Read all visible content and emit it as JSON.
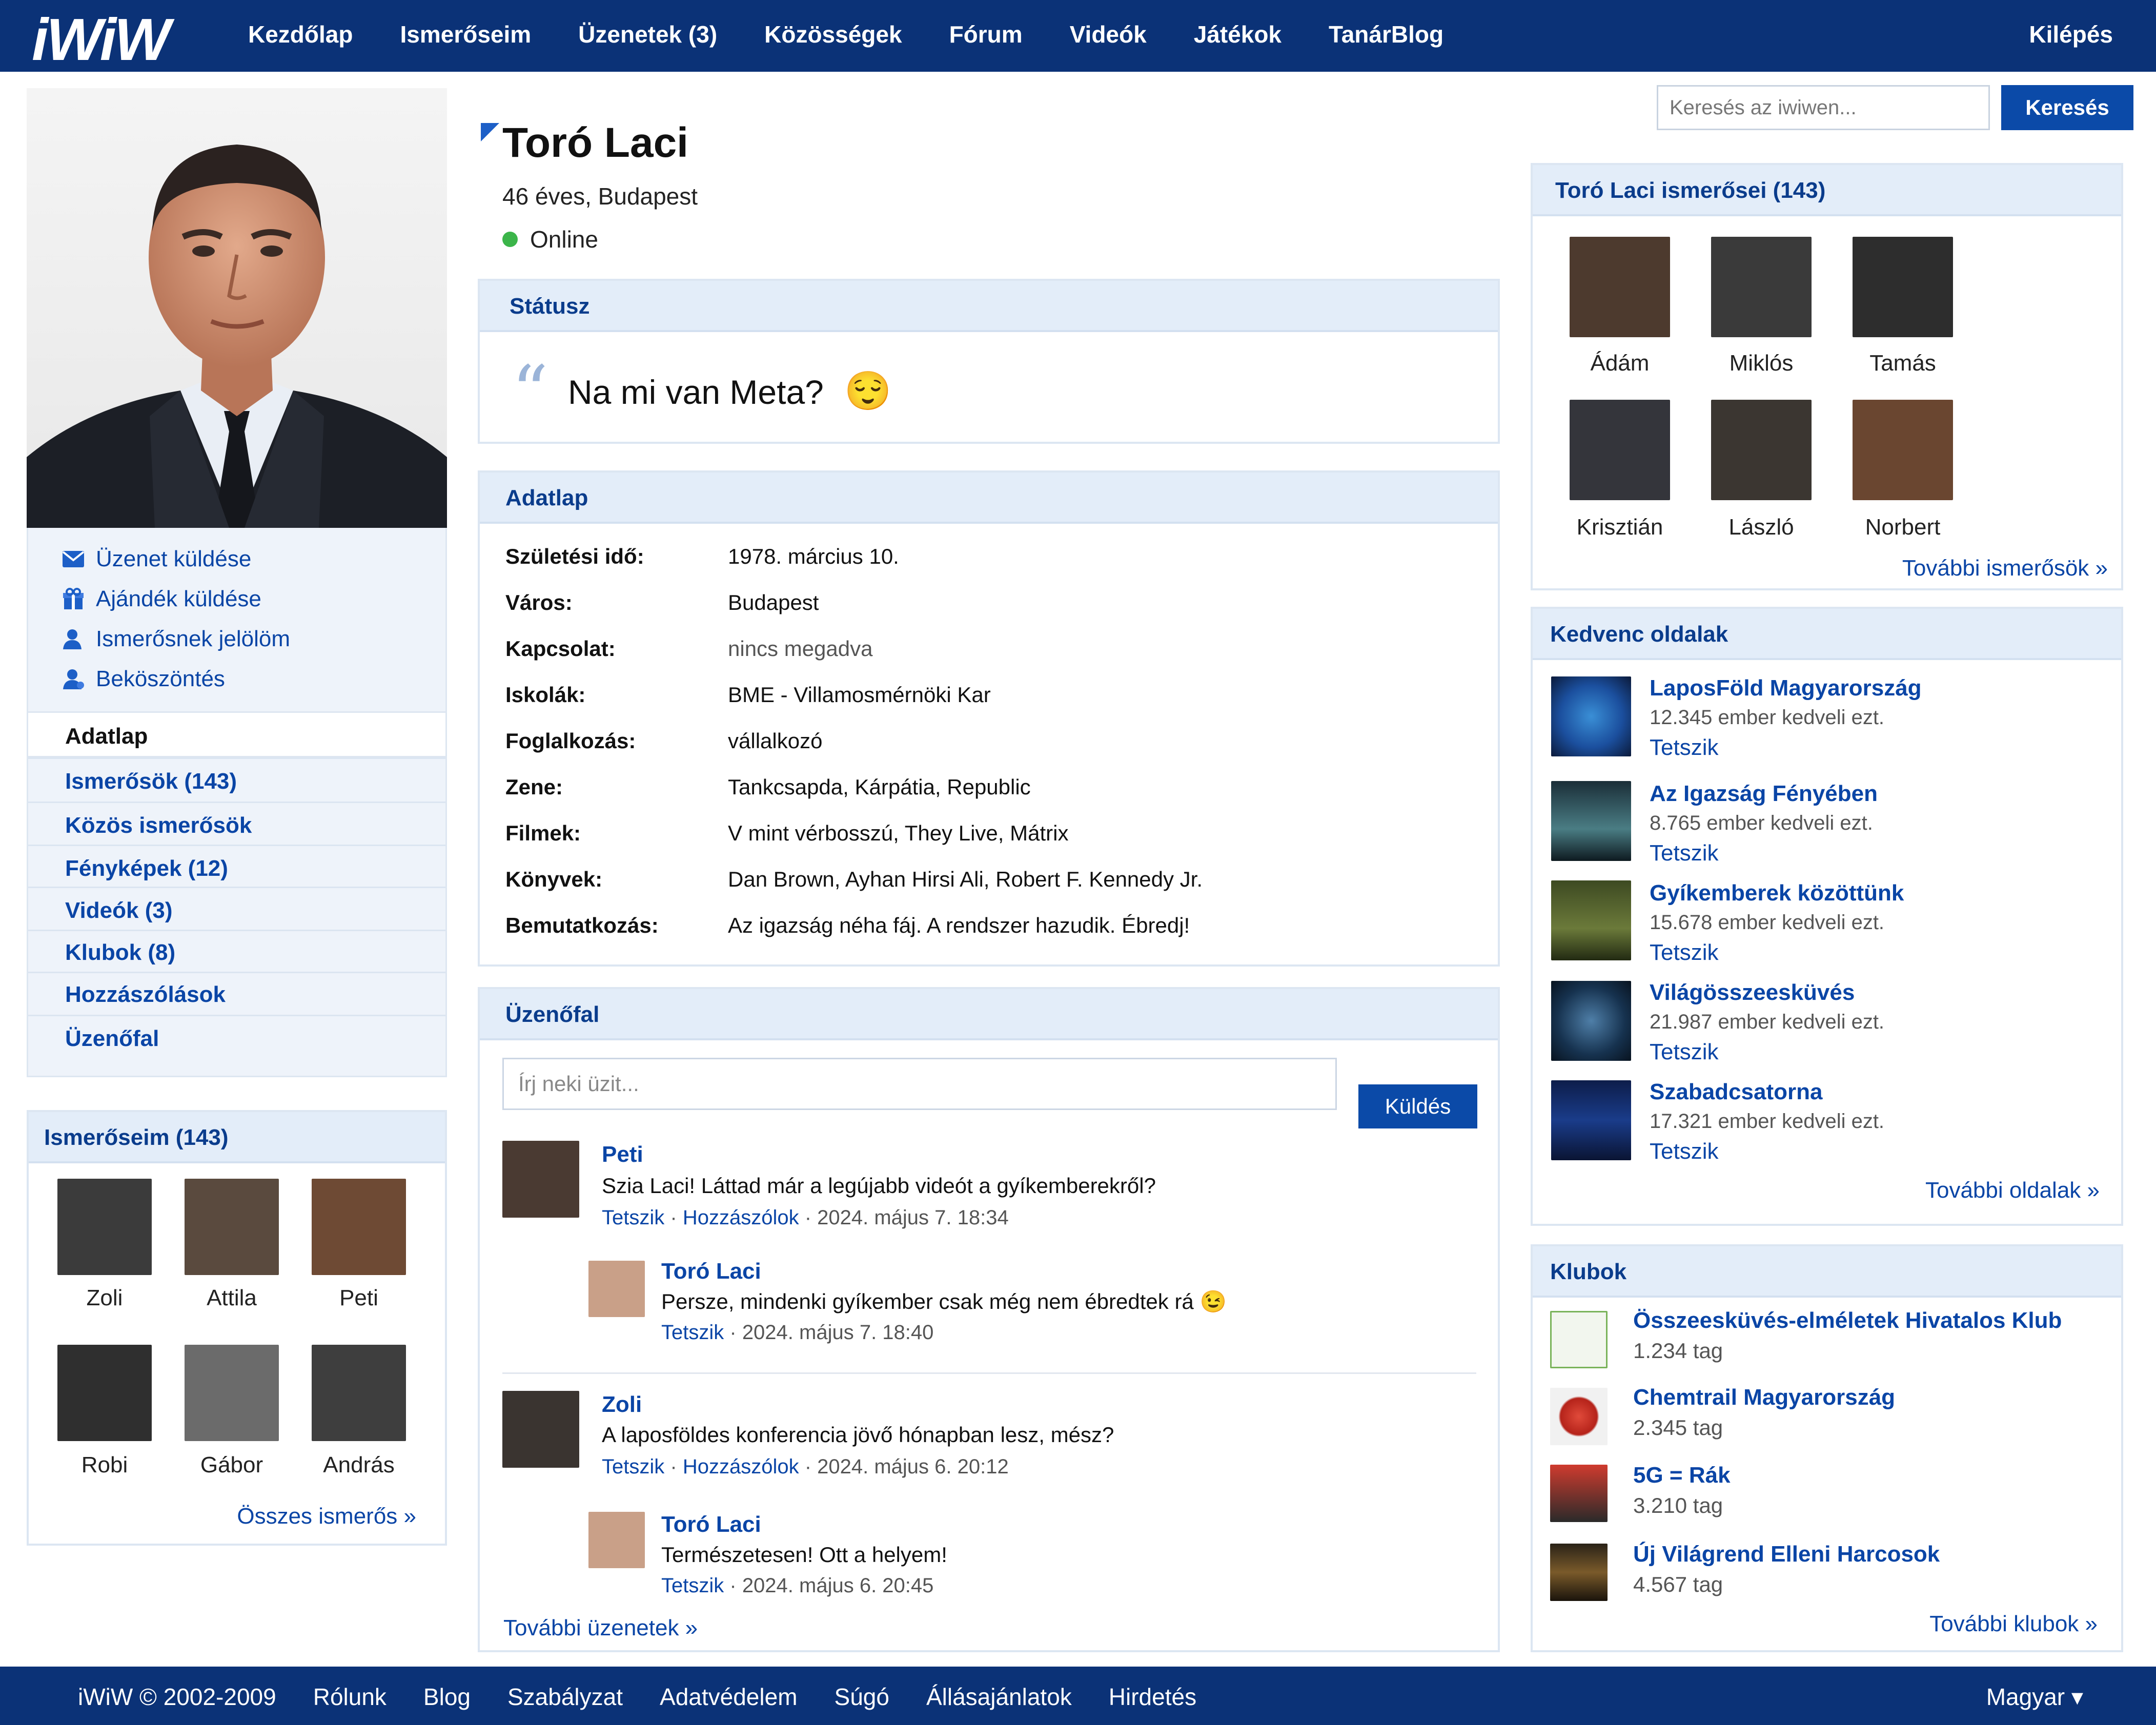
{
  "colors": {
    "brand": "#0b3277",
    "accent": "#0b4aa8",
    "link": "#0a45a6",
    "online": "#3bb54a",
    "panel_header": "#e3edf9"
  },
  "topbar": {
    "logo": "iWiW",
    "nav": [
      "Kezdőlap",
      "Ismerőseim",
      "Üzenetek (3)",
      "Közösségek",
      "Fórum",
      "Videók",
      "Játékok",
      "TanárBlog"
    ],
    "logout": "Kilépés"
  },
  "search": {
    "placeholder": "Keresés az iwiwen...",
    "button": "Keresés"
  },
  "profile": {
    "name": "Toró Laci",
    "subtitle": "46 éves, Budapest",
    "online": "Online"
  },
  "left": {
    "actions": [
      {
        "label": "Üzenet küldése",
        "icon": "envelope-icon"
      },
      {
        "label": "Ajándék küldése",
        "icon": "gift-icon"
      },
      {
        "label": "Ismerősnek jelölöm",
        "icon": "user-add-icon"
      },
      {
        "label": "Beköszöntés",
        "icon": "user-wave-icon"
      }
    ],
    "menu": [
      "Adatlap",
      "Ismerősök (143)",
      "Közös ismerősök",
      "Fényképek (12)",
      "Videók (3)",
      "Klubok (8)",
      "Hozzászólások",
      "Üzenőfal"
    ],
    "friends": {
      "title": "Ismerőseim (143)",
      "names": [
        "Zoli",
        "Attila",
        "Peti",
        "Robi",
        "Gábor",
        "András"
      ],
      "more": "Összes ismerős »"
    }
  },
  "status": {
    "title": "Státusz",
    "text": "Na mi van Meta?",
    "emoji": "😌"
  },
  "adatlap": {
    "title": "Adatlap",
    "rows": [
      {
        "label": "Születési idő:",
        "value": "1978. március 10."
      },
      {
        "label": "Város:",
        "value": "Budapest"
      },
      {
        "label": "Kapcsolat:",
        "value": "nincs megadva"
      },
      {
        "label": "Iskolák:",
        "value": "BME - Villamosmérnöki Kar"
      },
      {
        "label": "Foglalkozás:",
        "value": "vállalkozó"
      },
      {
        "label": "Zene:",
        "value": "Tankcsapda, Kárpátia, Republic"
      },
      {
        "label": "Filmek:",
        "value": "V mint vérbosszú, They Live, Mátrix"
      },
      {
        "label": "Könyvek:",
        "value": "Dan Brown, Ayhan Hirsi Ali, Robert F. Kennedy Jr."
      },
      {
        "label": "Bemutatkozás:",
        "value": "Az igazság néha fáj. A rendszer hazudik. Ébredj!"
      }
    ]
  },
  "wall": {
    "title": "Üzenőfal",
    "placeholder": "Írj neki üzit...",
    "send": "Küldés",
    "like": "Tetszik",
    "comment": "Hozzászólok",
    "more": "További üzenetek »",
    "posts": [
      {
        "author": "Peti",
        "text": "Szia Laci! Láttad már a legújabb videót a gyíkemberekről?",
        "time": "2024. május 7. 18:34",
        "reply": {
          "author": "Toró Laci",
          "text": "Persze, mindenki gyíkember csak még nem ébredtek rá 😉",
          "time": "2024. május 7. 18:40"
        }
      },
      {
        "author": "Zoli",
        "text": "A laposföldes konferencia jövő hónapban lesz, mész?",
        "time": "2024. május 6. 20:12",
        "reply": {
          "author": "Toró Laci",
          "text": "Természetesen! Ott a helyem!",
          "time": "2024. május 6. 20:45"
        }
      }
    ]
  },
  "right_friends": {
    "title": "Toró Laci ismerősei (143)",
    "names": [
      "Ádám",
      "Miklós",
      "Tamás",
      "Krisztián",
      "László",
      "Norbert"
    ],
    "more": "További ismerősök »"
  },
  "fav_pages": {
    "title": "Kedvenc oldalak",
    "like": "Tetszik",
    "items": [
      {
        "title": "LaposFöld Magyarország",
        "sub": "12.345 ember kedveli ezt."
      },
      {
        "title": "Az Igazság Fényében",
        "sub": "8.765 ember kedveli ezt."
      },
      {
        "title": "Gyíkemberek közöttünk",
        "sub": "15.678 ember kedveli ezt."
      },
      {
        "title": "Világösszeesküvés",
        "sub": "21.987 ember kedveli ezt."
      },
      {
        "title": "Szabadcsatorna",
        "sub": "17.321 ember kedveli ezt."
      }
    ],
    "more": "További oldalak »"
  },
  "clubs": {
    "title": "Klubok",
    "items": [
      {
        "title": "Összeesküvés-elméletek Hivatalos Klub",
        "sub": "1.234 tag"
      },
      {
        "title": "Chemtrail Magyarország",
        "sub": "2.345 tag"
      },
      {
        "title": "5G = Rák",
        "sub": "3.210 tag"
      },
      {
        "title": "Új Világrend Elleni Harcosok",
        "sub": "4.567 tag"
      }
    ],
    "more": "További klubok »"
  },
  "footer": {
    "links": [
      "iWiW © 2002-2009",
      "Rólunk",
      "Blog",
      "Szabályzat",
      "Adatvédelem",
      "Súgó",
      "Állásajánlatok",
      "Hirdetés"
    ],
    "language": "Magyar ▾"
  }
}
